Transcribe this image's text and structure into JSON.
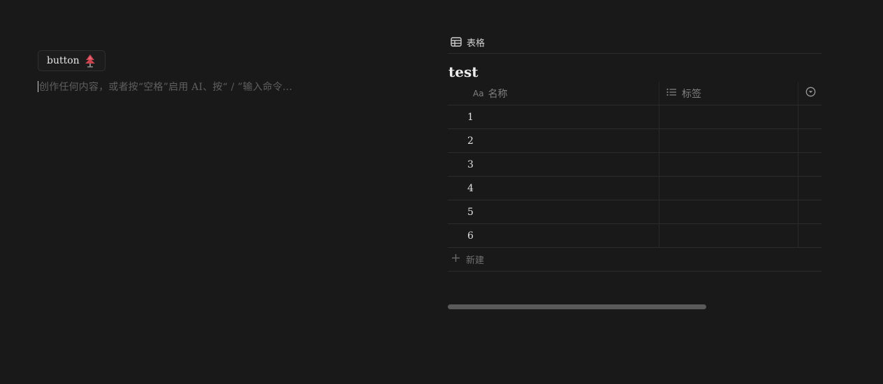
{
  "editor": {
    "button_label": "button",
    "button_emoji": "tree-emoji",
    "placeholder": "创作任何内容，或者按“空格”启用 AI、按“ / ”输入命令…"
  },
  "database": {
    "view_tab_label": "表格",
    "title": "test",
    "columns": [
      {
        "label": "名称",
        "type_icon": "Aa"
      },
      {
        "label": "标签",
        "type_icon": "list-icon"
      }
    ],
    "rows": [
      {
        "name": "1",
        "tags": ""
      },
      {
        "name": "2",
        "tags": ""
      },
      {
        "name": "3",
        "tags": ""
      },
      {
        "name": "4",
        "tags": ""
      },
      {
        "name": "5",
        "tags": ""
      },
      {
        "name": "6",
        "tags": ""
      }
    ],
    "new_label": "新建"
  },
  "colors": {
    "background": "#191919",
    "border": "#2c2c2c",
    "muted_text": "#7f7f7f",
    "scrollbar": "#5a5a5a"
  }
}
